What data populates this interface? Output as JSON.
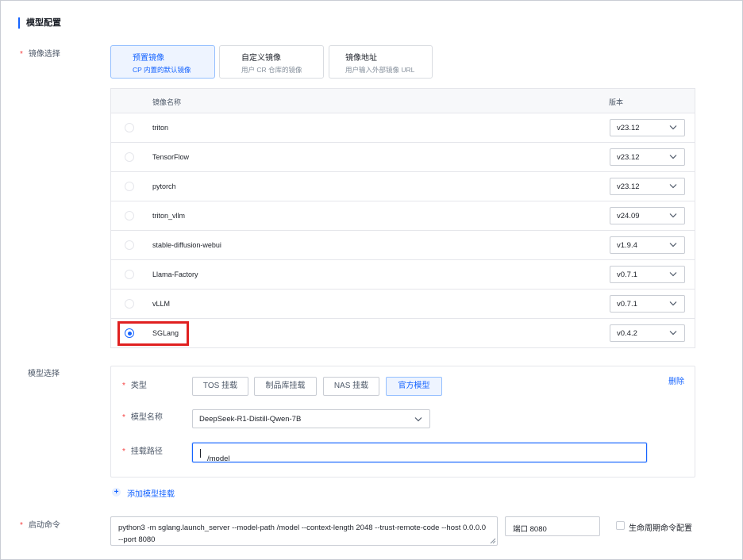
{
  "section": {
    "title": "模型配置"
  },
  "image_select": {
    "label": "镜像选择",
    "tabs": [
      {
        "title": "预置镜像",
        "desc": "CP 内置的默认镜像",
        "active": true
      },
      {
        "title": "自定义镜像",
        "desc": "用户 CR 仓库的镜像",
        "active": false
      },
      {
        "title": "镜像地址",
        "desc": "用户输入外部镜像 URL",
        "active": false
      }
    ],
    "table": {
      "col_name": "镜像名称",
      "col_version": "版本",
      "rows": [
        {
          "name": "triton",
          "version": "v23.12",
          "selected": false
        },
        {
          "name": "TensorFlow",
          "version": "v23.12",
          "selected": false
        },
        {
          "name": "pytorch",
          "version": "v23.12",
          "selected": false
        },
        {
          "name": "triton_vllm",
          "version": "v24.09",
          "selected": false
        },
        {
          "name": "stable-diffusion-webui",
          "version": "v1.9.4",
          "selected": false
        },
        {
          "name": "Llama-Factory",
          "version": "v0.7.1",
          "selected": false
        },
        {
          "name": "vLLM",
          "version": "v0.7.1",
          "selected": false
        },
        {
          "name": "SGLang",
          "version": "v0.4.2",
          "selected": true
        }
      ]
    }
  },
  "model_select": {
    "label": "模型选择",
    "type_label": "类型",
    "type_options": [
      {
        "label": "TOS 挂载",
        "active": false
      },
      {
        "label": "制品库挂载",
        "active": false
      },
      {
        "label": "NAS 挂载",
        "active": false
      },
      {
        "label": "官方模型",
        "active": true
      }
    ],
    "delete_label": "删除",
    "name_label": "模型名称",
    "name_value": "DeepSeek-R1-Distill-Qwen-7B",
    "path_label": "挂载路径",
    "path_value": "/model",
    "add_label": "添加模型挂载"
  },
  "launch": {
    "label": "启动命令",
    "command": "python3 -m sglang.launch_server --model-path /model --context-length 2048 --trust-remote-code --host 0.0.0.0 --port 8080",
    "port_text": "端口 8080",
    "lifecycle_label": "生命周期命令配置"
  },
  "colors": {
    "accent": "#1664ff",
    "required": "#f53f3f",
    "highlight": "#e02020"
  }
}
